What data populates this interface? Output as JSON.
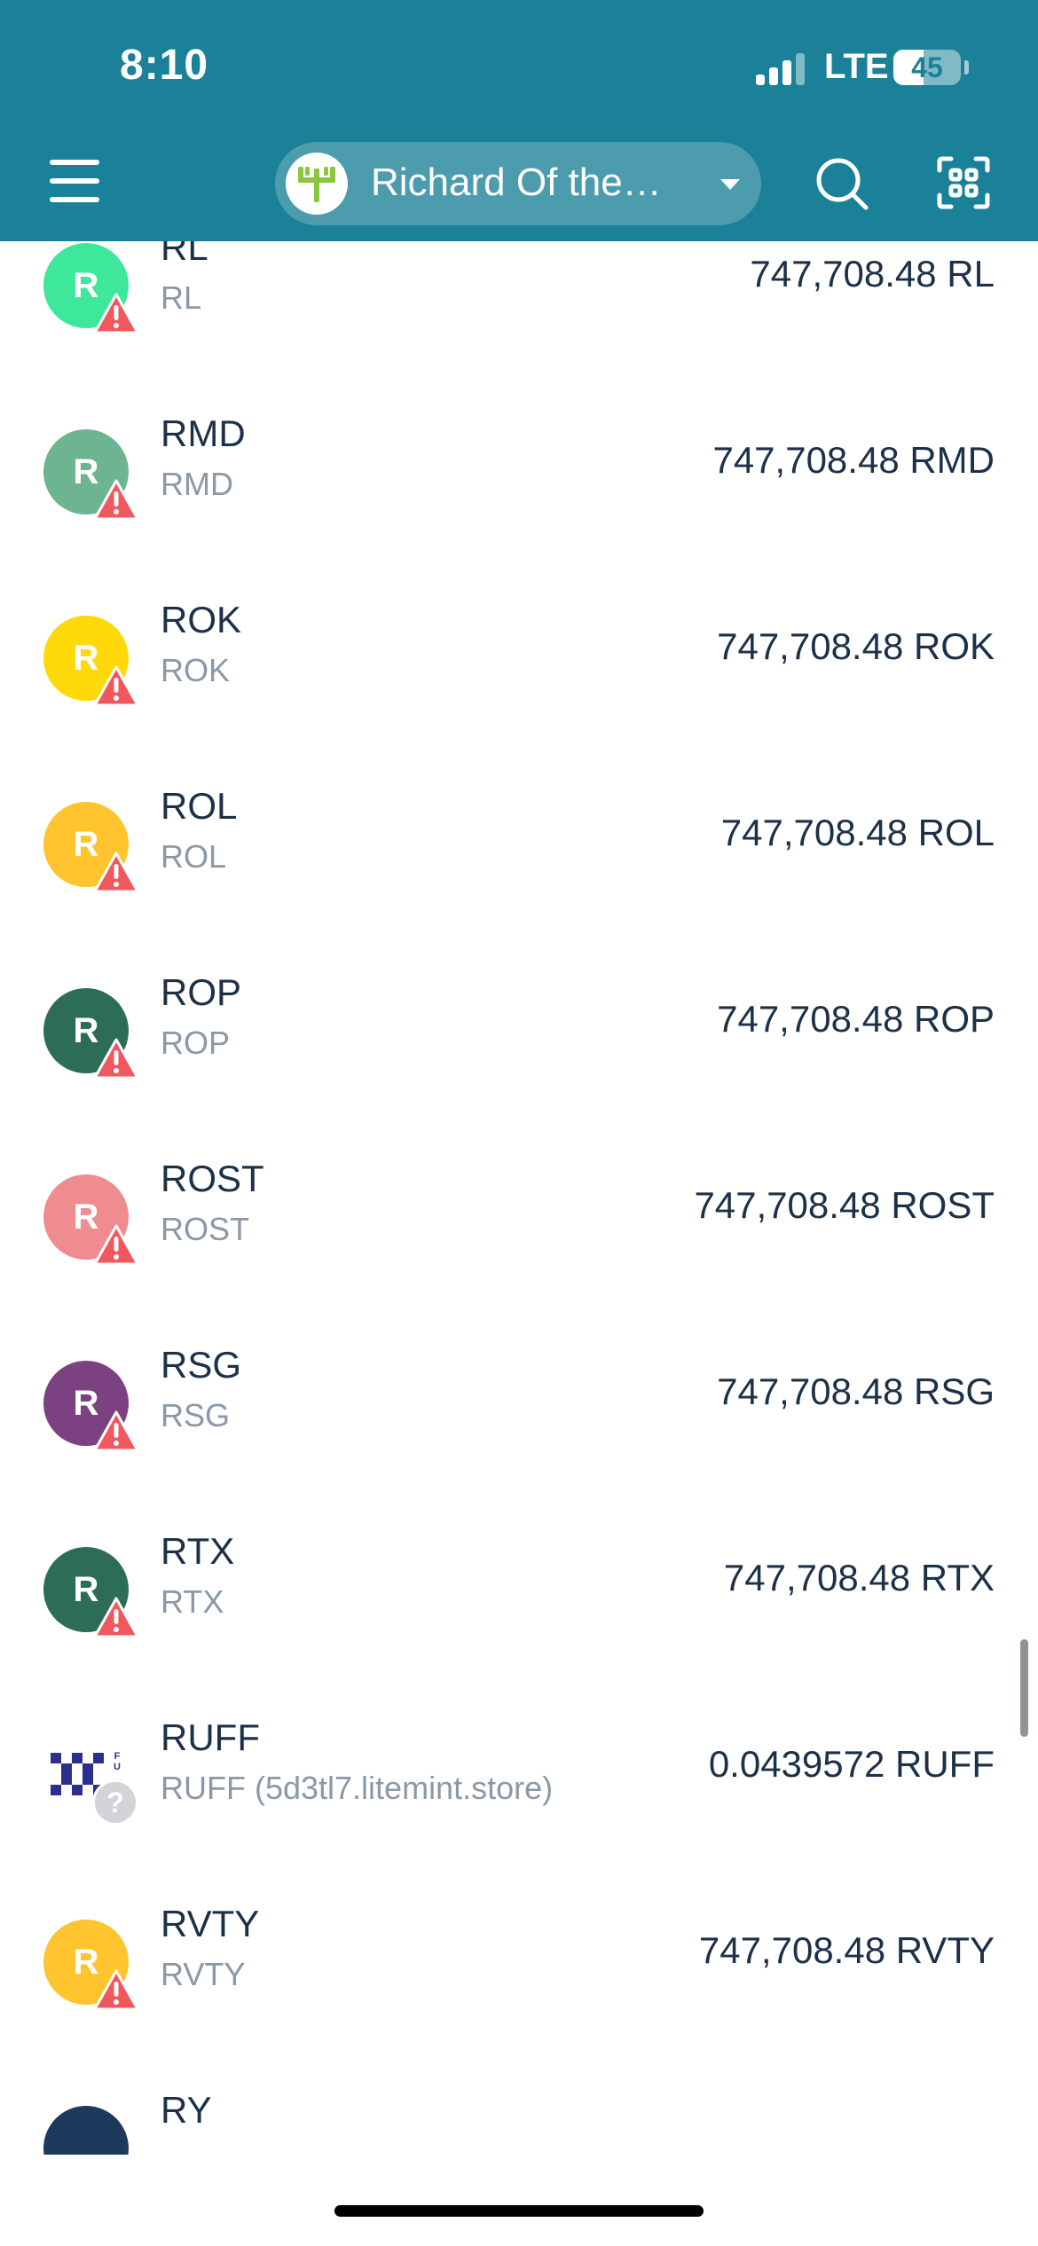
{
  "status_bar": {
    "time": "8:10",
    "network": "LTE",
    "battery": "45",
    "battery_level": 0.45
  },
  "header": {
    "wallet_name": "Richard Of the…",
    "menu_icon": "hamburger-menu-icon",
    "search_icon": "search-icon",
    "scan_icon": "qr-scan-icon",
    "dropdown_icon": "chevron-down-icon"
  },
  "colors": {
    "header_bg": "#1a8198",
    "warning": "#f0585e",
    "text_primary": "#1c3148",
    "text_secondary": "#8b98a6"
  },
  "tokens": [
    {
      "code": "RL",
      "name": "RL",
      "balance": "747,708.48 RL",
      "letter": "R",
      "color": "#3ee89a",
      "badge": "warning"
    },
    {
      "code": "RMD",
      "name": "RMD",
      "balance": "747,708.48 RMD",
      "letter": "R",
      "color": "#6db591",
      "badge": "warning"
    },
    {
      "code": "ROK",
      "name": "ROK",
      "balance": "747,708.48 ROK",
      "letter": "R",
      "color": "#ffd90a",
      "badge": "warning"
    },
    {
      "code": "ROL",
      "name": "ROL",
      "balance": "747,708.48 ROL",
      "letter": "R",
      "color": "#ffc42e",
      "badge": "warning"
    },
    {
      "code": "ROP",
      "name": "ROP",
      "balance": "747,708.48 ROP",
      "letter": "R",
      "color": "#2d6d58",
      "badge": "warning"
    },
    {
      "code": "ROST",
      "name": "ROST",
      "balance": "747,708.48 ROST",
      "letter": "R",
      "color": "#ef8c8f",
      "badge": "warning"
    },
    {
      "code": "RSG",
      "name": "RSG",
      "balance": "747,708.48 RSG",
      "letter": "R",
      "color": "#7c4181",
      "badge": "warning"
    },
    {
      "code": "RTX",
      "name": "RTX",
      "balance": "747,708.48 RTX",
      "letter": "R",
      "color": "#2d6d58",
      "badge": "warning"
    },
    {
      "code": "RUFF",
      "name": "RUFF (5d3tl7.litemint.store)",
      "balance": "0.0439572 RUFF",
      "letter": "",
      "color": "#ffffff",
      "badge": "unknown",
      "logo": "ruff-logo",
      "logo_text": "FU"
    },
    {
      "code": "RVTY",
      "name": "RVTY",
      "balance": "747,708.48 RVTY",
      "letter": "R",
      "color": "#ffc42e",
      "badge": "warning"
    },
    {
      "code": "RY",
      "name": "",
      "balance": "",
      "letter": "",
      "color": "#1d3a5c",
      "badge": "none"
    }
  ]
}
